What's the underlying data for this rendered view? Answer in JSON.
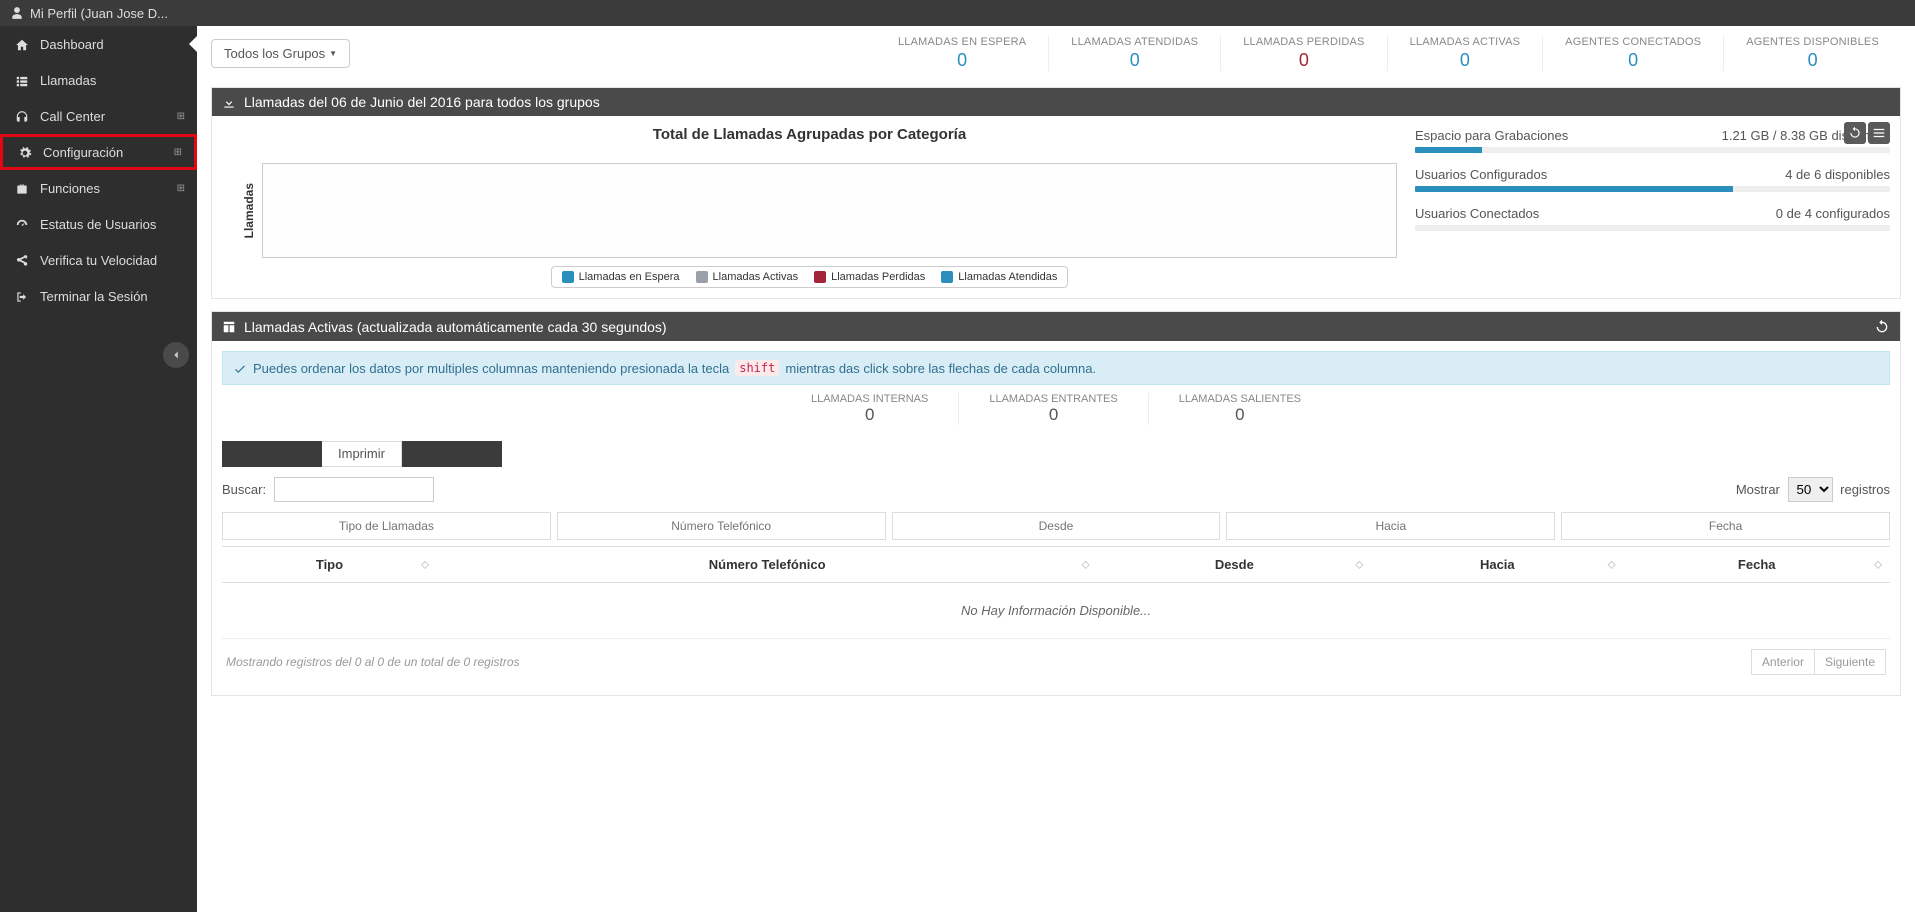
{
  "topbar": {
    "profile_label": "Mi Perfil (Juan Jose D..."
  },
  "sidebar": {
    "items": [
      {
        "label": "Dashboard",
        "icon": "home",
        "expandable": false,
        "active": true
      },
      {
        "label": "Llamadas",
        "icon": "list",
        "expandable": false
      },
      {
        "label": "Call Center",
        "icon": "headphones",
        "expandable": true
      },
      {
        "label": "Configuración",
        "icon": "cogs",
        "expandable": true,
        "highlight": true
      },
      {
        "label": "Funciones",
        "icon": "briefcase",
        "expandable": true
      },
      {
        "label": "Estatus de Usuarios",
        "icon": "dashboard",
        "expandable": false
      },
      {
        "label": "Verifica tu Velocidad",
        "icon": "share",
        "expandable": false
      },
      {
        "label": "Terminar la Sesión",
        "icon": "signout",
        "expandable": false
      }
    ]
  },
  "header": {
    "group_filter": "Todos los Grupos",
    "kpis": [
      {
        "label": "LLAMADAS EN ESPERA",
        "value": "0",
        "color": "blue"
      },
      {
        "label": "LLAMADAS ATENDIDAS",
        "value": "0",
        "color": "blue"
      },
      {
        "label": "LLAMADAS PERDIDAS",
        "value": "0",
        "color": "red"
      },
      {
        "label": "LLAMADAS ACTIVAS",
        "value": "0",
        "color": "blue"
      },
      {
        "label": "AGENTES CONECTADOS",
        "value": "0",
        "color": "blue"
      },
      {
        "label": "AGENTES DISPONIBLES",
        "value": "0",
        "color": "blue"
      }
    ]
  },
  "chart_panel": {
    "header": "Llamadas del 06 de Junio del 2016 para todos los grupos",
    "title": "Total de Llamadas Agrupadas por Categoría",
    "ylabel": "Llamadas",
    "legend": [
      {
        "label": "Llamadas en Espera",
        "color": "#2a8fbd"
      },
      {
        "label": "Llamadas Activas",
        "color": "#9aa0a8"
      },
      {
        "label": "Llamadas Perdidas",
        "color": "#a32638"
      },
      {
        "label": "Llamadas Atendidas",
        "color": "#2a8fbd"
      }
    ],
    "stats": [
      {
        "label": "Espacio para Grabaciones",
        "value": "1.21 GB / 8.38 GB disponible",
        "pct": 14
      },
      {
        "label": "Usuarios Configurados",
        "value": "4 de 6 disponibles",
        "pct": 67
      },
      {
        "label": "Usuarios Conectados",
        "value": "0 de 4 configurados",
        "pct": 0
      }
    ]
  },
  "active_panel": {
    "header": "Llamadas Activas (actualizada automáticamente cada 30 segundos)",
    "tip_pre": "Puedes ordenar los datos por multiples columnas manteniendo presionada la tecla",
    "tip_code": "shift",
    "tip_post": "mientras das click sobre las flechas de cada columna.",
    "sub_kpis": [
      {
        "label": "LLAMADAS INTERNAS",
        "value": "0"
      },
      {
        "label": "LLAMADAS ENTRANTES",
        "value": "0"
      },
      {
        "label": "LLAMADAS SALIENTES",
        "value": "0"
      }
    ],
    "print_label": "Imprimir",
    "search_label": "Buscar:",
    "show_label": "Mostrar",
    "show_value": "50",
    "records_label": "registros",
    "filter_placeholders": [
      "Tipo de Llamadas",
      "Número Telefónico",
      "Desde",
      "Hacia",
      "Fecha"
    ],
    "columns": [
      "Tipo",
      "Número Telefónico",
      "Desde",
      "Hacia",
      "Fecha"
    ],
    "empty_text": "No Hay Información Disponible...",
    "footer_info": "Mostrando registros del 0 al 0 de un total de 0 registros",
    "pager_prev": "Anterior",
    "pager_next": "Siguiente"
  },
  "chart_data": {
    "type": "bar",
    "title": "Total de Llamadas Agrupadas por Categoría",
    "ylabel": "Llamadas",
    "categories": [],
    "series": [
      {
        "name": "Llamadas en Espera",
        "values": []
      },
      {
        "name": "Llamadas Activas",
        "values": []
      },
      {
        "name": "Llamadas Perdidas",
        "values": []
      },
      {
        "name": "Llamadas Atendidas",
        "values": []
      }
    ],
    "ylim": [
      0,
      0
    ]
  }
}
